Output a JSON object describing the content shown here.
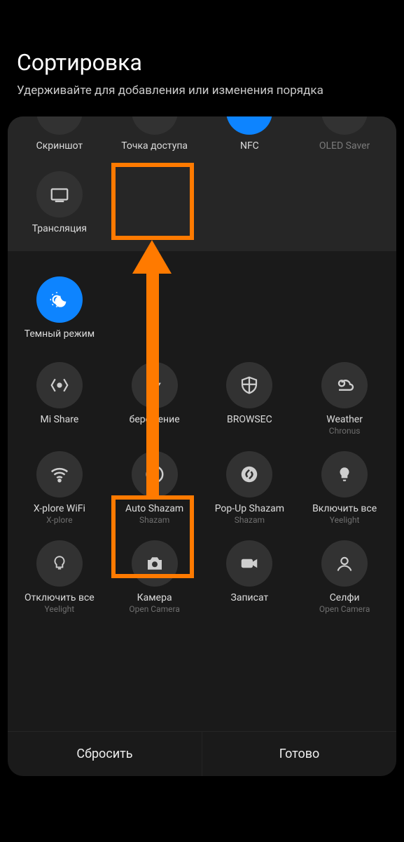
{
  "header": {
    "title": "Сортировка",
    "subtitle": "Удерживайте для добавления или изменения порядка"
  },
  "top_row_cut": [
    {
      "label": "Скриншот",
      "icon": "blank",
      "active": false,
      "dim": false
    },
    {
      "label": "Точка доступа",
      "icon": "blank",
      "active": false,
      "dim": false
    },
    {
      "label": "NFC",
      "icon": "blank",
      "active": true,
      "dim": false
    },
    {
      "label": "OLED Saver",
      "icon": "blank",
      "active": false,
      "dim": true
    }
  ],
  "top_row2": [
    {
      "label": "Трансляция",
      "icon": "cast",
      "active": false
    }
  ],
  "mid_row": [
    {
      "label": "Темный режим",
      "icon": "darkmode",
      "active": true
    }
  ],
  "lower_rows": [
    [
      {
        "label": "Mi Share",
        "sub": "",
        "icon": "mishare"
      },
      {
        "label": "бережение",
        "sub": "",
        "icon": "bolt"
      },
      {
        "label": "BROWSEC",
        "sub": "",
        "icon": "shield"
      },
      {
        "label": "Weather",
        "sub": "Chronus",
        "icon": "weather"
      }
    ],
    [
      {
        "label": "X-plore WiFi",
        "sub": "X-plore",
        "icon": "wifi"
      },
      {
        "label": "Auto Shazam",
        "sub": "Shazam",
        "icon": "shazam"
      },
      {
        "label": "Pop-Up Shazam",
        "sub": "Shazam",
        "icon": "shazam"
      },
      {
        "label": "Включить все",
        "sub": "Yeelight",
        "icon": "bulb"
      }
    ],
    [
      {
        "label": "Отключить все",
        "sub": "Yeelight",
        "icon": "bulb-off"
      },
      {
        "label": "Камера",
        "sub": "Open Camera",
        "icon": "camera"
      },
      {
        "label": "Записат",
        "sub": "",
        "icon": "video"
      },
      {
        "label": "Селфи",
        "sub": "Open Camera",
        "icon": "selfie"
      }
    ]
  ],
  "buttons": {
    "reset": "Сбросить",
    "done": "Готово"
  },
  "annotation": {
    "highlight_source": "Auto Shazam",
    "highlight_target": "empty-slot",
    "color": "#ff7a00"
  }
}
